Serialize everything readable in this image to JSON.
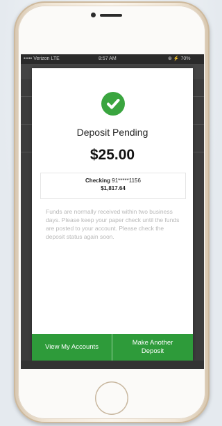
{
  "status_bar": {
    "carrier": "••••• Verizon LTE",
    "time": "8:57 AM",
    "battery": "⊕ ⚡ 70%"
  },
  "modal": {
    "title": "Deposit Pending",
    "amount": "$25.00",
    "account_label": "Checking",
    "account_number": "91*****1156",
    "account_balance": "$1,817.64",
    "note": "Funds are normally received within two business days. Please keep your paper check until the funds are posted to your account. Please check the deposit status again soon.",
    "buttons": {
      "view_accounts": "View My Accounts",
      "another_deposit_line1": "Make Another",
      "another_deposit_line2": "Deposit"
    }
  },
  "colors": {
    "accent_green": "#2e9b3a",
    "check_green": "#3aa53f"
  },
  "icons": {
    "success": "check-circle-icon"
  }
}
